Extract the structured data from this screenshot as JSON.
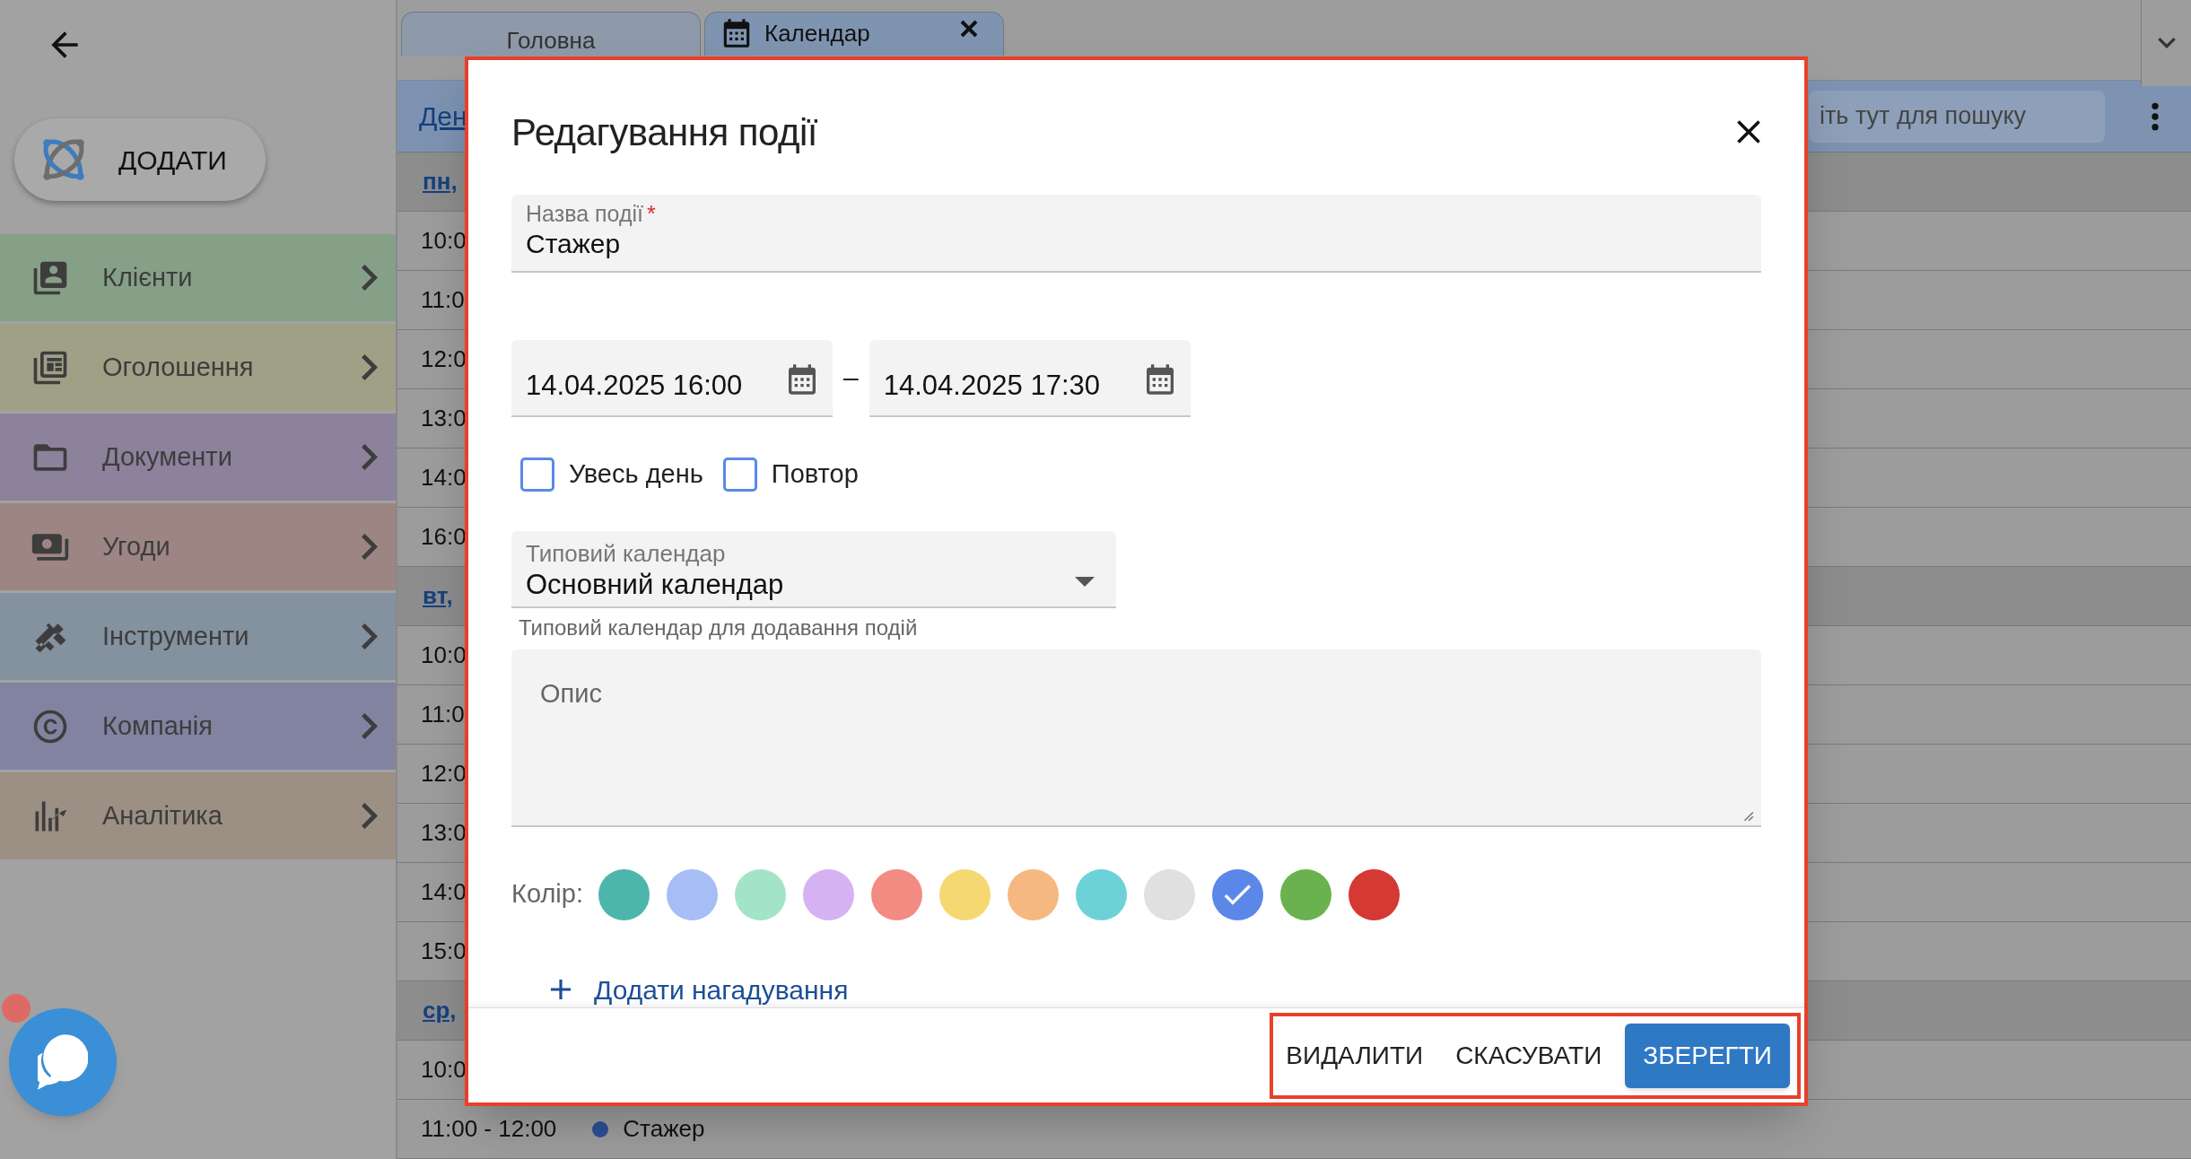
{
  "sidebar": {
    "add_button": "ДОДАТИ",
    "items": [
      {
        "label": "Клієнти",
        "color": "#86a088"
      },
      {
        "label": "Оголошення",
        "color": "#9fa086"
      },
      {
        "label": "Документи",
        "color": "#8c829c"
      },
      {
        "label": "Угоди",
        "color": "#9c8583"
      },
      {
        "label": "Інструменти",
        "color": "#84919e"
      },
      {
        "label": "Компанія",
        "color": "#8283a0"
      },
      {
        "label": "Аналітика",
        "color": "#9c8f84"
      }
    ]
  },
  "tabs": [
    {
      "label": "Головна",
      "selected": false
    },
    {
      "label": "Календар",
      "selected": true
    }
  ],
  "toolbar": {
    "view_link": "Ден",
    "search": {
      "placeholder": "іть тут для пошуку"
    }
  },
  "agenda": [
    {
      "day": "пн,",
      "slots": [
        {
          "time": "10:0"
        },
        {
          "time": "11:0"
        },
        {
          "time": "12:0"
        },
        {
          "time": "13:0"
        },
        {
          "time": "14:0"
        },
        {
          "time": "16:0"
        }
      ]
    },
    {
      "day": "вт,",
      "slots": [
        {
          "time": "10:0"
        },
        {
          "time": "11:0"
        },
        {
          "time": "12:0"
        },
        {
          "time": "13:0"
        },
        {
          "time": "14:0"
        },
        {
          "time": "15:0"
        }
      ]
    },
    {
      "day": "ср,",
      "slots": [
        {
          "time": "10:0"
        },
        {
          "time": "11:00 - 12:00",
          "title": "Стажер",
          "color": "#2c4f95"
        }
      ]
    }
  ],
  "dialog": {
    "title": "Редагування події",
    "name_field": {
      "label": "Назва події",
      "required_mark": "*",
      "value": "Стажер"
    },
    "start": "14.04.2025 16:00",
    "separator": "–",
    "end": "14.04.2025 17:30",
    "checkboxes": [
      {
        "label": "Увесь день",
        "checked": false
      },
      {
        "label": "Повтор",
        "checked": false
      }
    ],
    "calendar_select": {
      "label": "Типовий календар",
      "value": "Основний календар",
      "helper": "Типовий календар для додавання подій"
    },
    "description": {
      "placeholder": "Опис"
    },
    "color_label": "Колір:",
    "colors": [
      {
        "color": "#4db6ac",
        "selected": false
      },
      {
        "color": "#a7bdf5",
        "selected": false
      },
      {
        "color": "#a3e4c7",
        "selected": false
      },
      {
        "color": "#d6b2f4",
        "selected": false
      },
      {
        "color": "#f28b82",
        "selected": false
      },
      {
        "color": "#f6d873",
        "selected": false
      },
      {
        "color": "#f5b880",
        "selected": false
      },
      {
        "color": "#6dd2d8",
        "selected": false
      },
      {
        "color": "#e0e0e0",
        "selected": false
      },
      {
        "color": "#5b87e8",
        "selected": true
      },
      {
        "color": "#6ab24f",
        "selected": false
      },
      {
        "color": "#d43934",
        "selected": false
      }
    ],
    "add_reminder": "Додати нагадування",
    "buttons": [
      {
        "label": "ВИДАЛИТИ",
        "kind": "text"
      },
      {
        "label": "СКАСУВАТИ",
        "kind": "text"
      },
      {
        "label": "ЗБЕРЕГТИ",
        "kind": "primary"
      }
    ]
  }
}
